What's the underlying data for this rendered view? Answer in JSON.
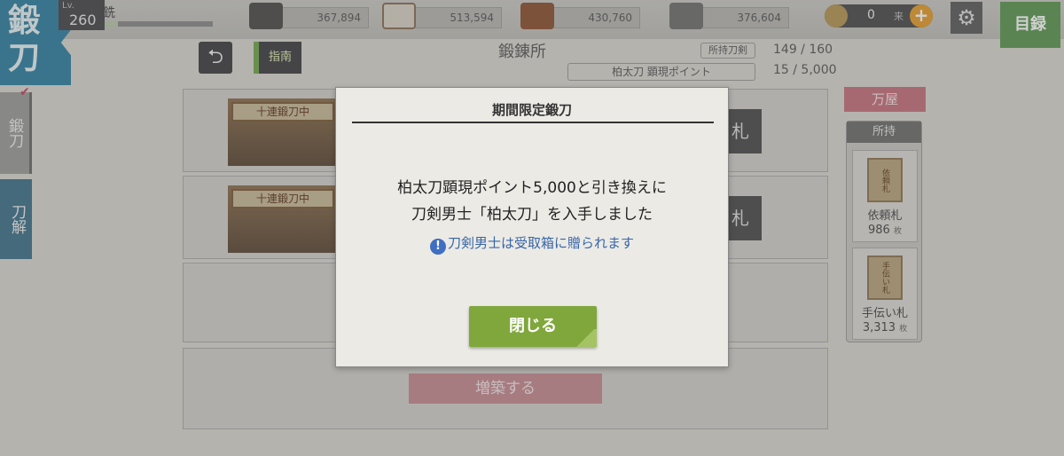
{
  "header": {
    "emblem": "鍛刀",
    "level_label": "Lv.",
    "level": "260",
    "player_name": "銑",
    "xp_fraction": 0.12
  },
  "resources": [
    {
      "icon": "charcoal-icon",
      "value": "367,894"
    },
    {
      "icon": "tamahagane-icon",
      "value": "513,594"
    },
    {
      "icon": "coolant-icon",
      "value": "430,760"
    },
    {
      "icon": "whetstone-icon",
      "value": "376,604"
    }
  ],
  "currency": {
    "value": "0",
    "unit": "来",
    "plus": "+"
  },
  "catalog_label": "目録",
  "side_tabs": {
    "forge": "鍛刀",
    "dismantle": "刀解"
  },
  "nav": {
    "guide": "指南",
    "back_symbol": "⮌"
  },
  "screen": {
    "title": "鍛錬所",
    "owned_label": "所持刀剣",
    "owned_count": "149 / 160",
    "points_label": "柏太刀 顕現ポイント",
    "points_count": "15 / 5,000"
  },
  "slots": [
    {
      "banner": "十連鍛刀中",
      "button": "札"
    },
    {
      "banner": "十連鍛刀中",
      "button": "札"
    }
  ],
  "expand_label": "増築する",
  "shop": {
    "tag": "万屋",
    "owned_header": "所持",
    "items": [
      {
        "card": "依頼札",
        "name": "依頼札",
        "count": "986",
        "unit": "枚"
      },
      {
        "card": "手伝い札",
        "name": "手伝い札",
        "count": "3,313",
        "unit": "枚"
      }
    ]
  },
  "modal": {
    "title": "期間限定鍛刀",
    "line1": "柏太刀顕現ポイント5,000と引き換えに",
    "line2": "刀剣男士「柏太刀」を入手しました",
    "note": "刀剣男士は受取箱に贈られます",
    "info_symbol": "!",
    "close_label": "閉じる"
  }
}
